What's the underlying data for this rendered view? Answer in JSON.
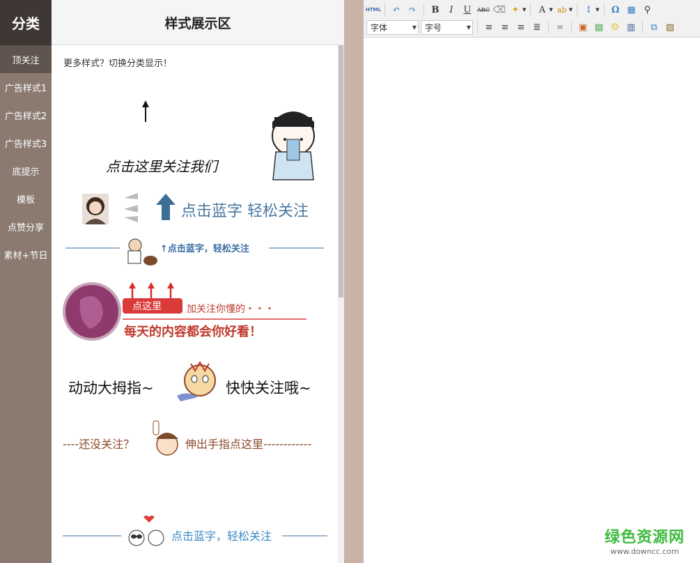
{
  "sidebar": {
    "header": "分类",
    "items": [
      {
        "label": "顶关注"
      },
      {
        "label": "广告样式1"
      },
      {
        "label": "广告样式2"
      },
      {
        "label": "广告样式3"
      },
      {
        "label": "底提示"
      },
      {
        "label": "模板"
      },
      {
        "label": "点赞分享"
      },
      {
        "label": "素材+节日"
      }
    ]
  },
  "panel": {
    "title": "样式展示区",
    "hint": "更多样式？切换分类显示！",
    "samples": {
      "s1_text": "点击这里关注我们",
      "s2_text": "点击蓝字 轻松关注",
      "s3_text": "↑点击蓝字，轻松关注",
      "s4_tag": "点这里",
      "s4_line1": "加关注你懂的・・・",
      "s4_line2": "每天的内容都会你好看！",
      "s5_left": "动动大拇指~",
      "s5_right": "快快关注哦~",
      "s6_left": "----还没关注？",
      "s6_right": "伸出手指点这里------------",
      "s7_text": "点击蓝字，轻松关注"
    }
  },
  "editor": {
    "toolbar": {
      "html": "HTML",
      "bold": "B",
      "italic": "I",
      "underline": "U",
      "strike": "ABC",
      "font_color": "A",
      "font_select": "字体",
      "size_select": "字号",
      "special_char": "Ω"
    }
  },
  "watermark": {
    "brand": "绿色资源网",
    "url": "www.downcc.com"
  },
  "colors": {
    "sidebar_bg": "#8a7a70",
    "sidebar_head": "#3f3733",
    "sidebar_active": "#5f544e",
    "divider": "#c9b2a6",
    "blue_text": "#3a6ea5",
    "red": "#d93a3a",
    "brown": "#8b4a2b",
    "watermark_green": "#3dbb3d"
  }
}
